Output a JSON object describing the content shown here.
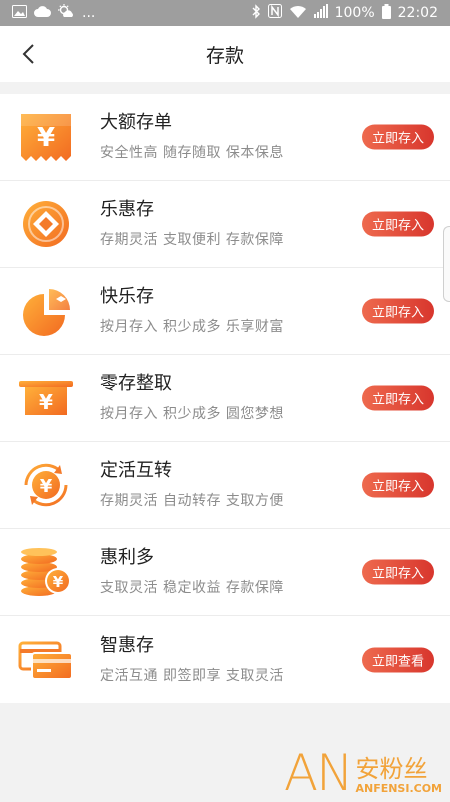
{
  "status_bar": {
    "left_ellipsis": "...",
    "battery_percent": "100%",
    "time": "22:02",
    "left_icons": [
      "image-icon",
      "cloud-icon",
      "weather-icon"
    ],
    "right_icons": [
      "bluetooth-icon",
      "nfc-icon",
      "wifi-icon",
      "signal-icon",
      "battery-icon"
    ]
  },
  "header": {
    "title": "存款"
  },
  "products": [
    {
      "name": "大额存单",
      "desc": "安全性高 随存随取 保本保息",
      "button": "立即存入",
      "icon": "certificate-yen-icon"
    },
    {
      "name": "乐惠存",
      "desc": "存期灵活 支取便利 存款保障",
      "button": "立即存入",
      "icon": "coin-diamond-icon"
    },
    {
      "name": "快乐存",
      "desc": "按月存入 积少成多 乐享财富",
      "button": "立即存入",
      "icon": "pie-chart-icon"
    },
    {
      "name": "零存整取",
      "desc": "按月存入 积少成多 圆您梦想",
      "button": "立即存入",
      "icon": "atm-yen-icon"
    },
    {
      "name": "定活互转",
      "desc": "存期灵活 自动转存 支取方便",
      "button": "立即存入",
      "icon": "yen-exchange-icon"
    },
    {
      "name": "惠利多",
      "desc": "支取灵活 稳定收益 存款保障",
      "button": "立即存入",
      "icon": "coin-stack-icon"
    },
    {
      "name": "智惠存",
      "desc": "定活互通 即签即享 支取灵活",
      "button": "立即查看",
      "icon": "cards-icon"
    }
  ],
  "watermark": {
    "logo": "AN",
    "cn": "安粉丝",
    "en": "ANFENSI.COM"
  },
  "colors": {
    "accent": "#f08a24",
    "button": "#e0452f",
    "bg": "#f2f2f2"
  }
}
